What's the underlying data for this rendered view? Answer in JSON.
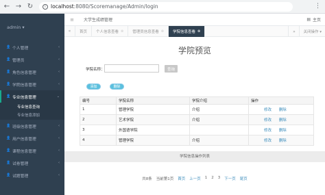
{
  "browser": {
    "url_host": "localhost",
    "url_path": ":8080/Scoremanage/Admin/login",
    "menu_icon": "more-vertical-icon"
  },
  "header": {
    "system_title": "大学生成绩管理",
    "right_label": "主页"
  },
  "sidebar": {
    "user": "admin ▾",
    "items": [
      {
        "label": "个人管理",
        "icon": "user-icon"
      },
      {
        "label": "管理员",
        "icon": "user-icon"
      },
      {
        "label": "角色信息管理",
        "icon": "user-icon"
      },
      {
        "label": "学院信息管理",
        "icon": "user-icon"
      },
      {
        "label": "专业信息管理",
        "icon": "user-icon"
      },
      {
        "label": "班级信息管理",
        "icon": "user-icon"
      },
      {
        "label": "用户信息管理",
        "icon": "user-icon"
      },
      {
        "label": "课程信息管理",
        "icon": "user-icon"
      },
      {
        "label": "试卷管理",
        "icon": "user-icon"
      },
      {
        "label": "试题管理",
        "icon": "user-icon"
      }
    ],
    "subitems": [
      "专业信息查询",
      "专业信息添加"
    ]
  },
  "tabs": {
    "items": [
      "首页",
      "个人信息查看",
      "管理员信息查看",
      "学院信息查看"
    ],
    "close_ops": "关闭操作 ▾"
  },
  "main": {
    "title": "学院预览",
    "search_label": "学院名称：",
    "search_value": "",
    "search_button": "查询",
    "btn_add": "添加",
    "btn_delete": "删除",
    "columns": [
      "编号",
      "学院名称",
      "学院介绍",
      "操作"
    ],
    "rows": [
      {
        "id": "1",
        "name": "管理学院",
        "intro": "介绍"
      },
      {
        "id": "2",
        "name": "艺术学院",
        "intro": "介绍"
      },
      {
        "id": "3",
        "name": "外国语学院",
        "intro": ""
      },
      {
        "id": "4",
        "name": "管理学院",
        "intro": "介绍"
      }
    ],
    "edit_label": "修改",
    "delete_label": "删除",
    "footer": "学院信息操作列表"
  },
  "pager": {
    "total": "共8条",
    "current": "当前第1页",
    "first": "首页",
    "prev": "上一页",
    "pages": [
      "1",
      "2",
      "3"
    ],
    "next": "下一页",
    "last": "尾页"
  },
  "colors": {
    "sidebar_bg": "#2f4050",
    "accent": "#5bc0de",
    "link": "#3c8dbc"
  }
}
